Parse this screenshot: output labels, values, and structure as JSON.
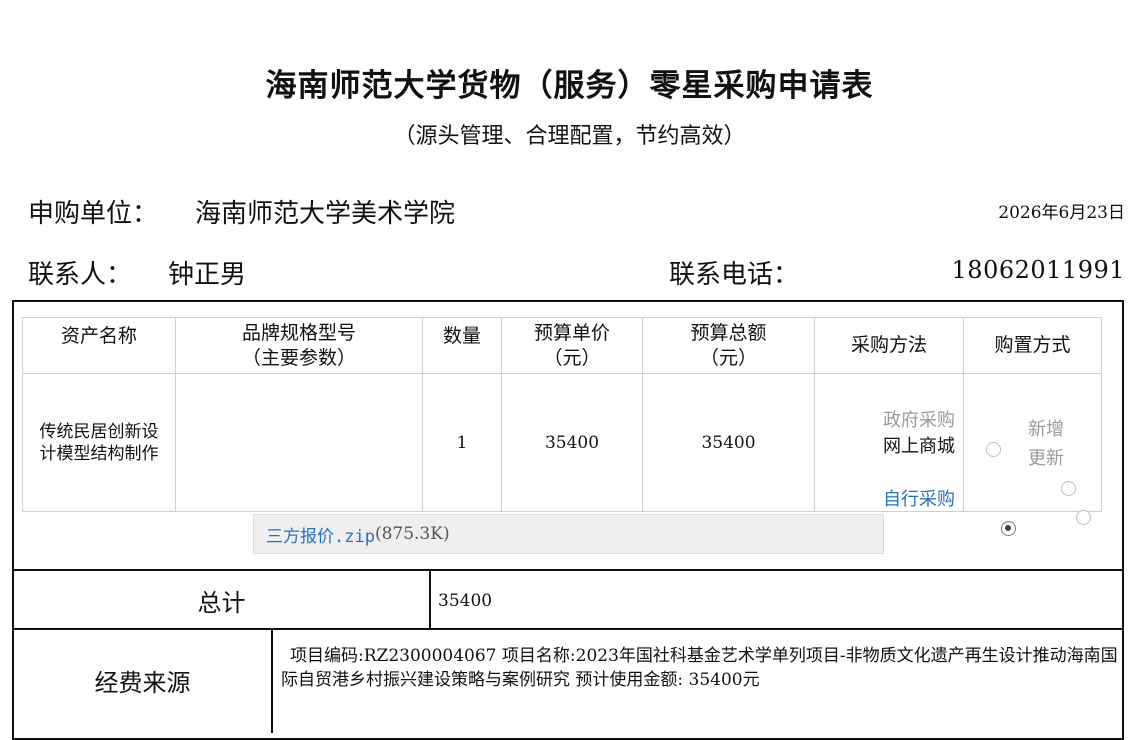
{
  "title": "海南师范大学货物（服务）零星采购申请表",
  "subtitle": "（源头管理、合理配置，节约高效）",
  "applicant_label": "申购单位：",
  "applicant_value": "海南师范大学美术学院",
  "date": "2026年6月23日",
  "contact_label": "联系人：",
  "contact_value": "钟正男",
  "phone_label": "联系电话：",
  "phone_value": "18062011991",
  "table": {
    "headers": {
      "asset_name": "资产名称",
      "brand_spec_line1": "品牌规格型号",
      "brand_spec_line2": "（主要参数）",
      "quantity": "数量",
      "unit_price_line1": "预算单价",
      "unit_price_line2": "（元）",
      "total_line1": "预算总额",
      "total_line2": "（元）",
      "method": "采购方法",
      "purchase_type": "购置方式"
    },
    "row": {
      "asset_name": "传统民居创新设计模型结构制作",
      "brand_spec": "",
      "quantity": "1",
      "unit_price": "35400",
      "total": "35400",
      "method_options": [
        {
          "label": "政府采购",
          "checked": false,
          "state": "disabled"
        },
        {
          "label": "网上商城",
          "checked": true,
          "state": "normal"
        },
        {
          "label": "自行采购",
          "checked": false,
          "state": "link"
        }
      ],
      "type_options": [
        {
          "label": "新增",
          "checked": false
        },
        {
          "label": "更新",
          "checked": false
        }
      ]
    }
  },
  "attachment": {
    "name": "三方报价.zip",
    "size": "(875.3K)"
  },
  "total_label": "总计",
  "total_value": "35400",
  "funding_label": "经费来源",
  "funding_text": "项目编码:RZ2300004067 项目名称:2023年国社科基金艺术学单列项目-非物质文化遗产再生设计推动海南国际自贸港乡村振兴建设策略与案例研究 预计使用金额: 35400元",
  "colors": {
    "link": "#2a6fba",
    "muted": "#9a9a9a",
    "attachment_bg": "#efefef"
  }
}
